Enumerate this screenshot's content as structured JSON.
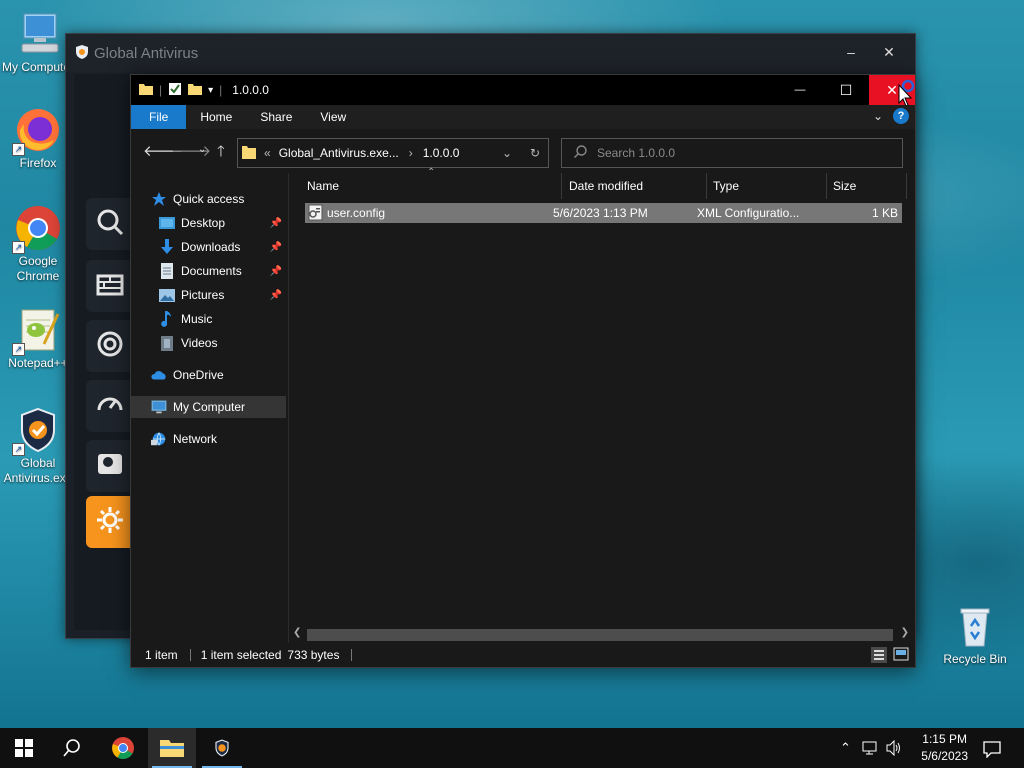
{
  "desktop": {
    "icons": [
      {
        "label": "My Computer"
      },
      {
        "label": "Firefox"
      },
      {
        "label": "Google Chrome"
      },
      {
        "label": "Notepad++"
      },
      {
        "label": "Global Antivirus.exe"
      },
      {
        "label": "Recycle Bin"
      }
    ]
  },
  "av_window": {
    "title": "Global Antivirus",
    "minimize_glyph": "–",
    "close_glyph": "✕",
    "accent_color": "#f7941d"
  },
  "explorer": {
    "title": "1.0.0.0",
    "controls": {
      "minimize": "—",
      "maximize": "☐",
      "close": "✕"
    },
    "ribbon": {
      "tabs": [
        "File",
        "Home",
        "Share",
        "View"
      ]
    },
    "address": {
      "path": [
        "Global_Antivirus.exe...",
        "1.0.0.0"
      ],
      "overflow": "«",
      "sep": "›"
    },
    "search": {
      "placeholder": "Search 1.0.0.0"
    },
    "nav": [
      {
        "label": "Quick access",
        "icon": "star-icon"
      },
      {
        "label": "Desktop",
        "icon": "desktop-folder-icon",
        "pinned": true
      },
      {
        "label": "Downloads",
        "icon": "downloads-icon",
        "pinned": true
      },
      {
        "label": "Documents",
        "icon": "documents-icon",
        "pinned": true
      },
      {
        "label": "Pictures",
        "icon": "pictures-icon",
        "pinned": true
      },
      {
        "label": "Music",
        "icon": "music-icon"
      },
      {
        "label": "Videos",
        "icon": "videos-icon"
      },
      {
        "label": "OneDrive",
        "icon": "onedrive-icon"
      },
      {
        "label": "My Computer",
        "icon": "computer-icon",
        "selected": true
      },
      {
        "label": "Network",
        "icon": "network-icon"
      }
    ],
    "columns": [
      "Name",
      "Date modified",
      "Type",
      "Size"
    ],
    "files": [
      {
        "name": "user.config",
        "date": "5/6/2023 1:13 PM",
        "type": "XML Configuratio...",
        "size": "1 KB",
        "selected": true
      }
    ],
    "status": {
      "count": "1 item",
      "selected": "1 item selected",
      "bytes": "733 bytes"
    }
  },
  "taskbar": {
    "time": "1:15 PM",
    "date": "5/6/2023"
  },
  "colors": {
    "selection": "#777777",
    "ribbon_file": "#1979ca",
    "close_hover": "#e81123"
  }
}
